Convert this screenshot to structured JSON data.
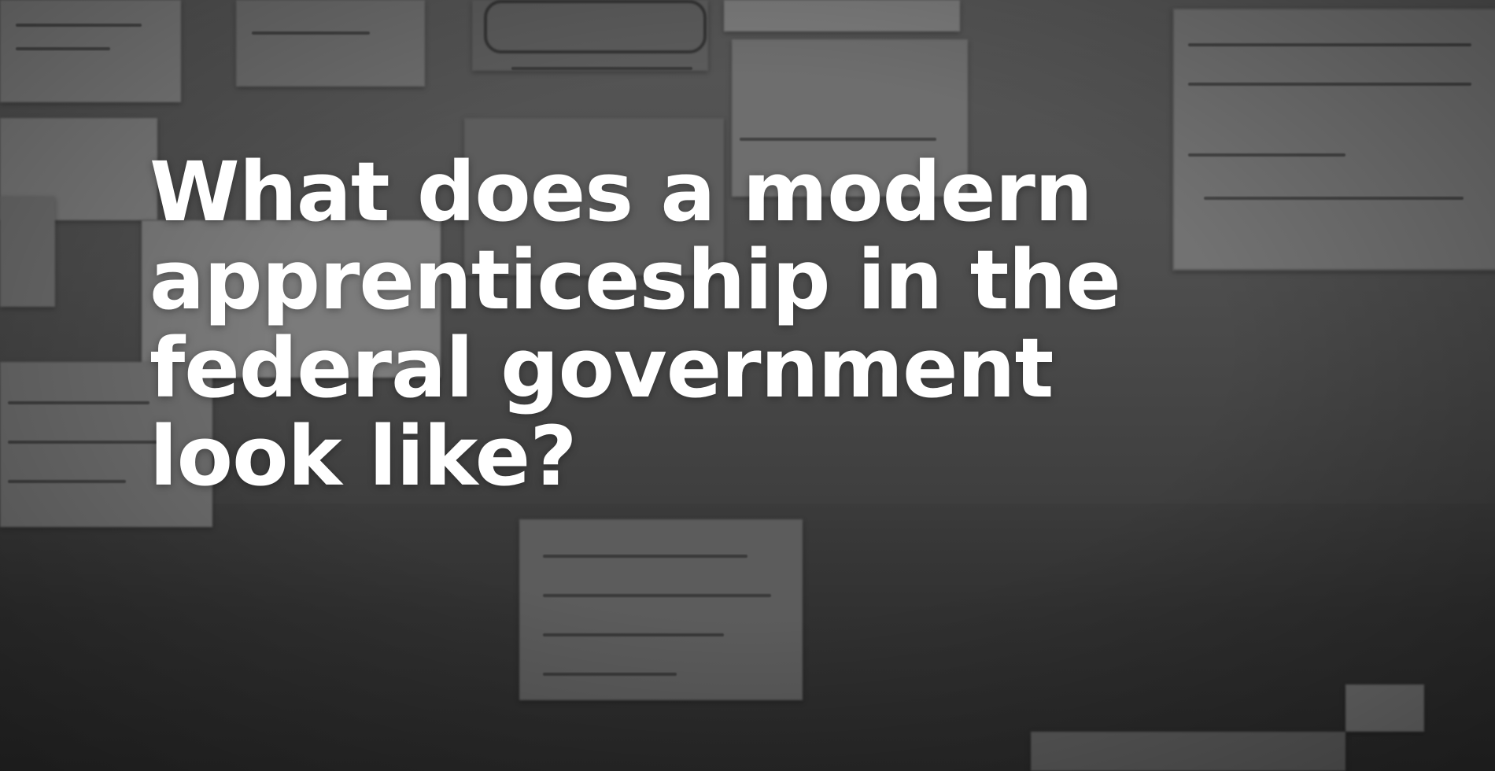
{
  "headline": {
    "line1": "What does a modern",
    "line2": "apprenticeship in the",
    "line3": "federal government",
    "line4": "look like?"
  },
  "palette": {
    "background": "#4a4a4a",
    "text": "#ffffff"
  }
}
